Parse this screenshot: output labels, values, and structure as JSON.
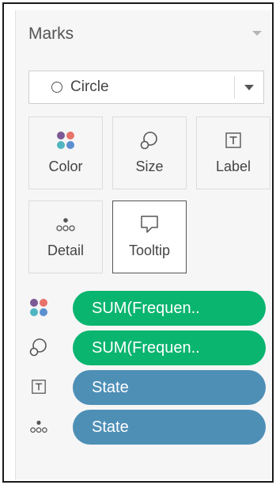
{
  "marks_card": {
    "title": "Marks",
    "mark_type": {
      "selected": "Circle",
      "icon": "circle-icon"
    },
    "buttons": [
      {
        "label": "Color",
        "icon": "color-dots-icon"
      },
      {
        "label": "Size",
        "icon": "size-lasso-icon"
      },
      {
        "label": "Label",
        "icon": "label-text-icon"
      },
      {
        "label": "Detail",
        "icon": "detail-dots-icon"
      },
      {
        "label": "Tooltip",
        "icon": "tooltip-bubble-icon"
      }
    ],
    "fields": [
      {
        "encoding": "color",
        "icon": "color-dots-icon",
        "label": "SUM(Frequen..",
        "color": "#0ab56f"
      },
      {
        "encoding": "size",
        "icon": "size-lasso-icon",
        "label": "SUM(Frequen..",
        "color": "#0ab56f"
      },
      {
        "encoding": "label",
        "icon": "label-text-icon",
        "label": "State",
        "color": "#4e8fb6"
      },
      {
        "encoding": "detail",
        "icon": "detail-dots-icon",
        "label": "State",
        "color": "#4e8fb6"
      }
    ]
  },
  "colors": {
    "measure_pill": "#0ab56f",
    "dimension_pill": "#4e8fb6",
    "dot_purple": "#7d5a96",
    "dot_red": "#e8736b",
    "dot_teal": "#4fb5c0",
    "dot_blue": "#5a8fd0"
  }
}
